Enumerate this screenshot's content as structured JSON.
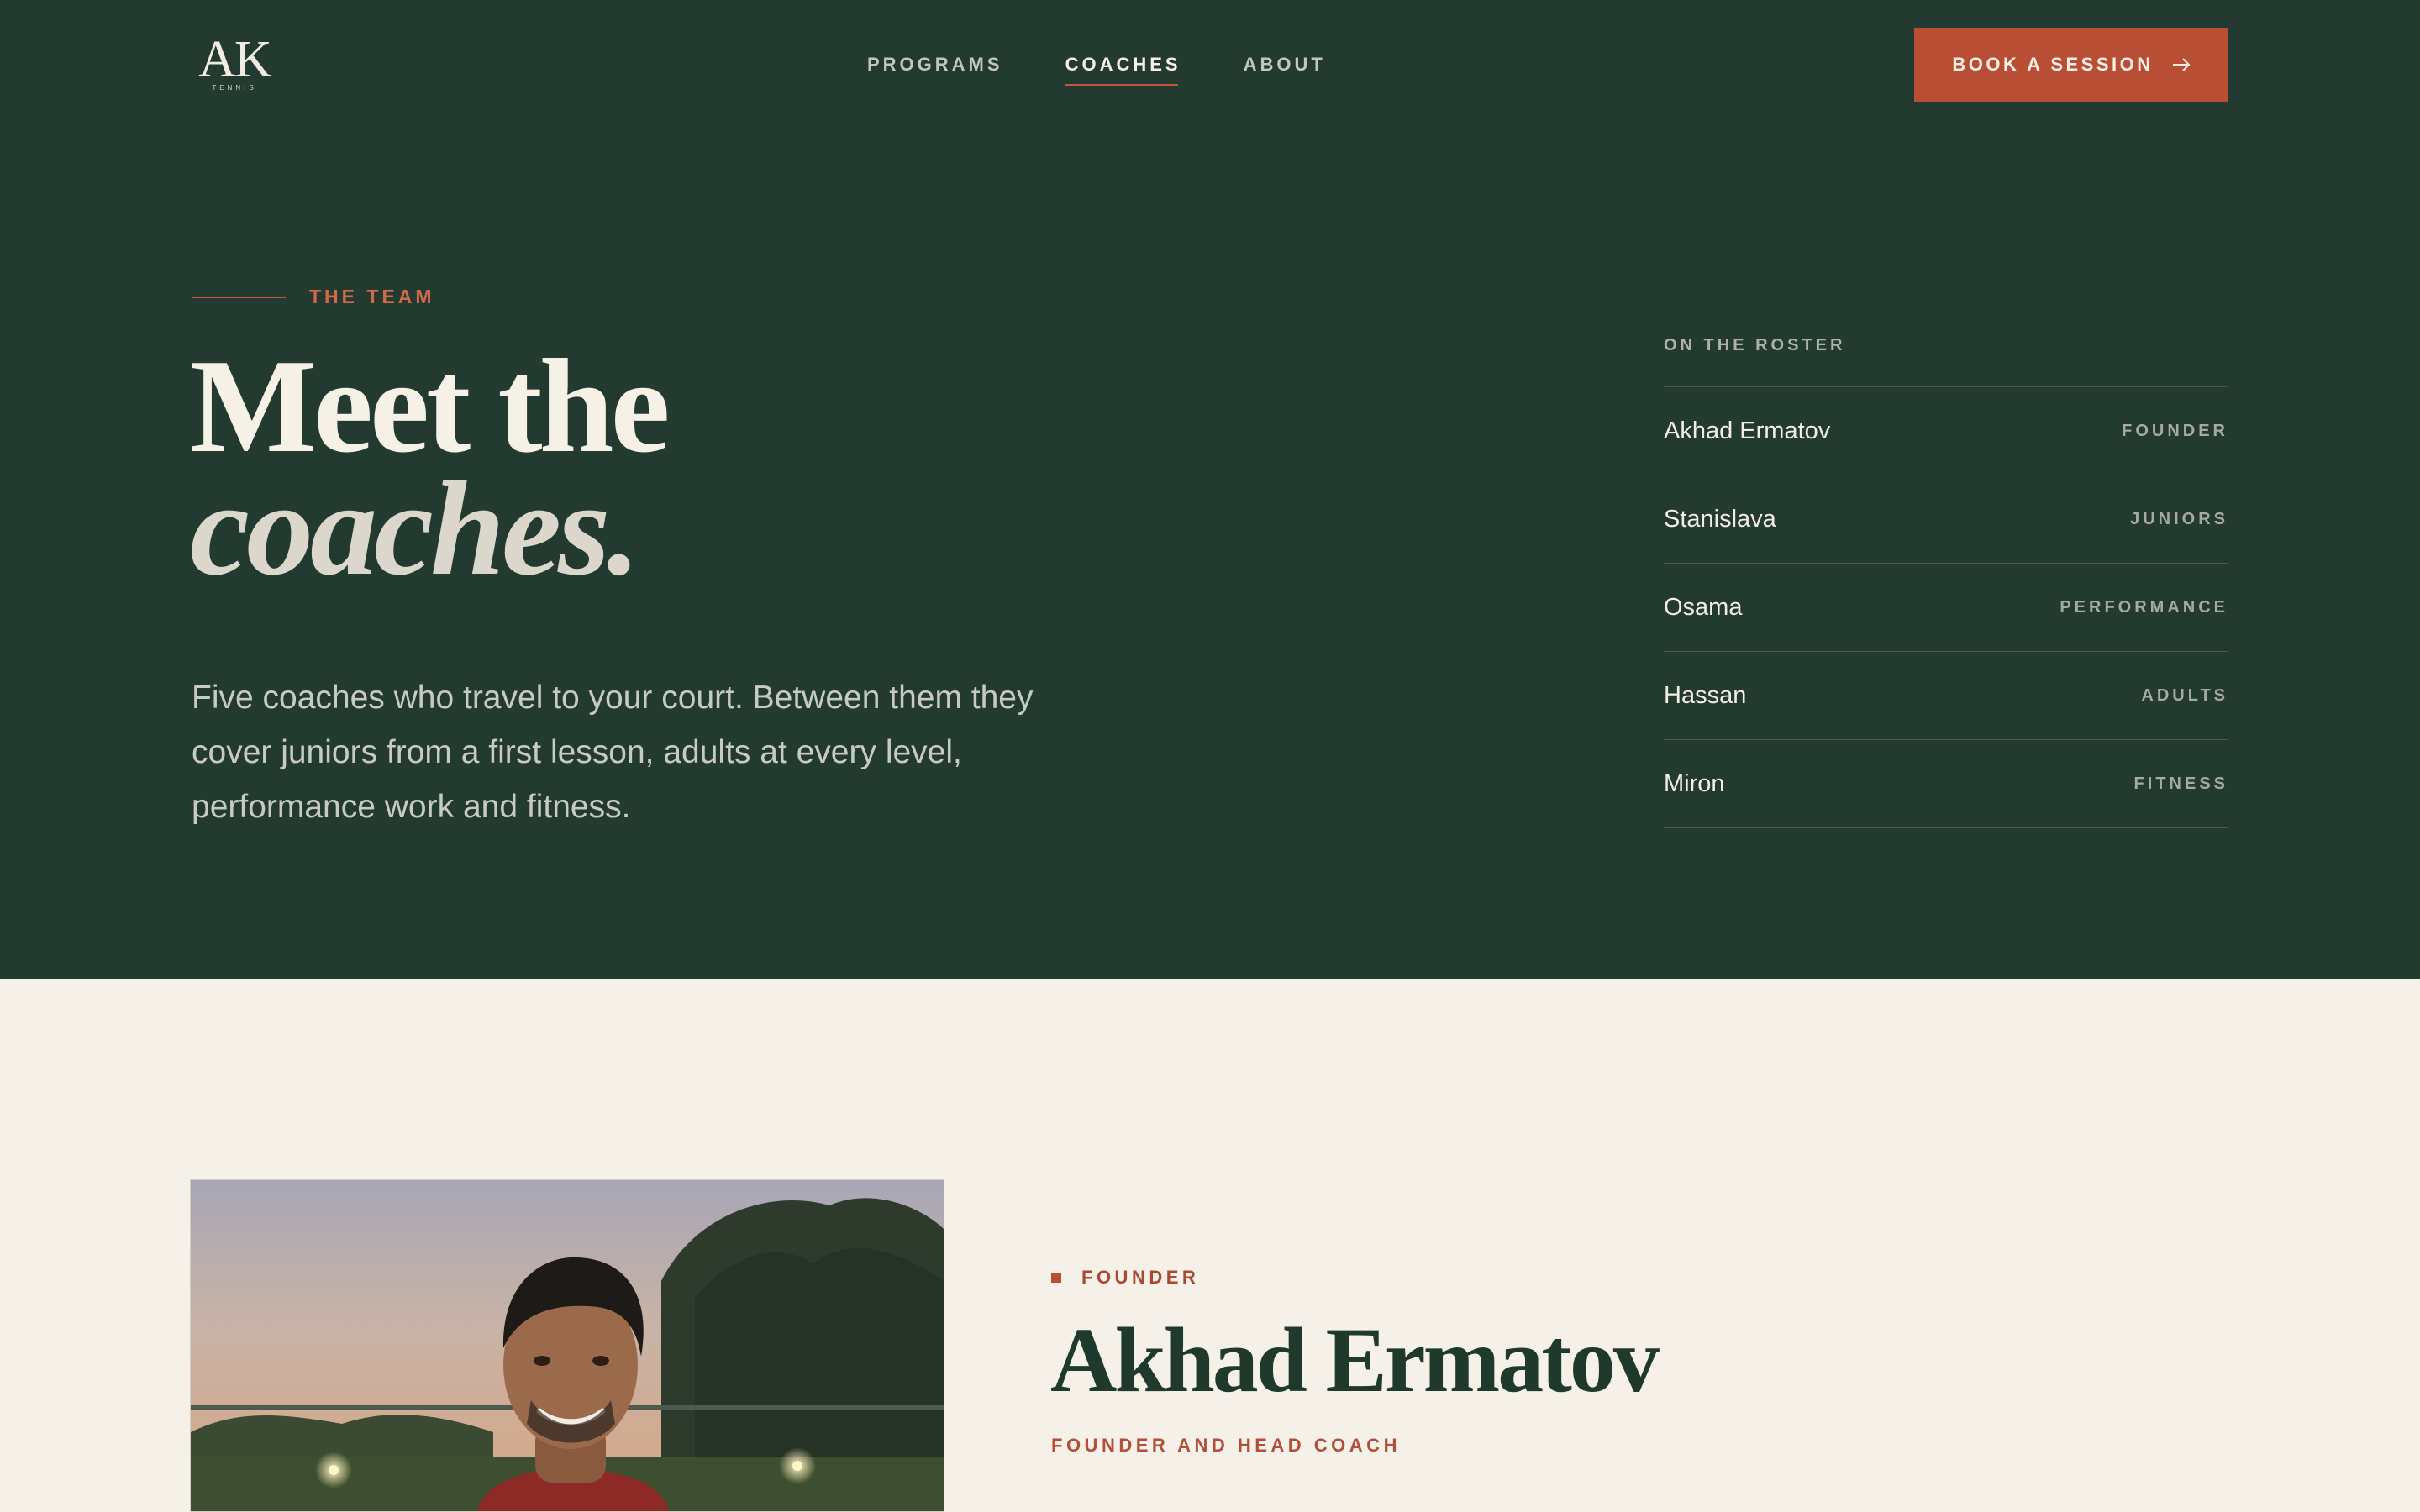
{
  "brand": {
    "logo_mark": "AK",
    "logo_sub": "TENNIS"
  },
  "nav": {
    "items": [
      {
        "label": "PROGRAMS",
        "active": false
      },
      {
        "label": "COACHES",
        "active": true
      },
      {
        "label": "ABOUT",
        "active": false
      }
    ]
  },
  "cta": {
    "label": "BOOK A SESSION",
    "icon": "arrow-right-icon"
  },
  "hero": {
    "eyebrow": "THE TEAM",
    "headline_line1": "Meet the",
    "headline_line2": "coaches.",
    "lead": "Five coaches who travel to your court. Between them they cover juniors from a first lesson, adults at every level, performance work and fitness."
  },
  "roster": {
    "title": "ON THE ROSTER",
    "rows": [
      {
        "name": "Akhad Ermatov",
        "role": "FOUNDER"
      },
      {
        "name": "Stanislava",
        "role": "JUNIORS"
      },
      {
        "name": "Osama",
        "role": "PERFORMANCE"
      },
      {
        "name": "Hassan",
        "role": "ADULTS"
      },
      {
        "name": "Miron",
        "role": "FITNESS"
      }
    ]
  },
  "profile": {
    "tag": "FOUNDER",
    "name": "Akhad Ermatov",
    "title": "FOUNDER AND HEAD COACH"
  },
  "colors": {
    "hero_bg": "#233a30",
    "accent": "#b84f35",
    "cream": "#f5f0e8",
    "heading_green": "#1f3a2d"
  }
}
